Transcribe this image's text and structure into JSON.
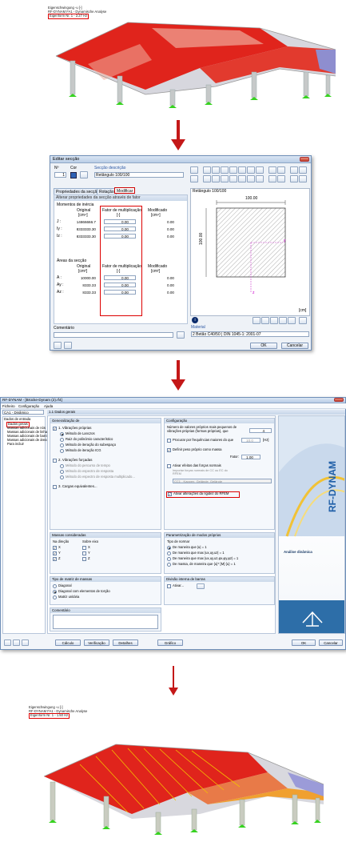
{
  "top_model": {
    "title_line1": "Eigenschwingung -u [-]",
    "title_line2": "RF-DYNAM FA1 - Dynamische Analyse",
    "title_line3": "Eigenform Nr. 1 - 2.27 Hz"
  },
  "section_dialog": {
    "title": "Editar secção",
    "number_label": "Nº",
    "number_value": "1",
    "color_label": "Cor",
    "desc_label": "Secção descrição",
    "desc_value": "Retângulo 100/100",
    "tabs": [
      "Propriedades da secção",
      "Rotação",
      "Modificar"
    ],
    "panel_title": "Alterar propriedades da secção através de fator",
    "inertia_title": "Momentos de inércia",
    "col_original": "Original",
    "col_original_unit1": "[cm⁴]",
    "col_factor": "Fator de multiplicação",
    "col_factor_unit": "[-]",
    "col_modified": "Modificado",
    "col_modified_unit1": "[cm⁴]",
    "inertia_rows": [
      {
        "sym": "J :",
        "orig": "14866666.7",
        "factor": "0.00",
        "mod": "0.00"
      },
      {
        "sym": "Iy :",
        "orig": "8333333.30",
        "factor": "0.00",
        "mod": "0.00"
      },
      {
        "sym": "Iz :",
        "orig": "8333333.30",
        "factor": "0.00",
        "mod": "0.00"
      }
    ],
    "area_title": "Áreas da secção",
    "col_original_unit2": "[cm²]",
    "col_modified_unit2": "[cm²]",
    "area_rows": [
      {
        "sym": "A :",
        "orig": "10000.00",
        "factor": "0.00",
        "mod": "0.00"
      },
      {
        "sym": "Ay :",
        "orig": "8333.33",
        "factor": "0.00",
        "mod": "0.00"
      },
      {
        "sym": "Az :",
        "orig": "8333.33",
        "factor": "0.00",
        "mod": "0.00"
      }
    ],
    "comment_label": "Comentário",
    "preview_title": "Retângulo 100/100",
    "dim_top": "100.00",
    "dim_left": "100.00",
    "axis_y": "y",
    "axis_z": "z",
    "unit": "[cm]",
    "material_label": "Material",
    "material_value": "2  Betão C40/50 | DIN 1045-1: 2001-07",
    "ok": "OK",
    "cancel": "Cancelar"
  },
  "dynam_dialog": {
    "title": "RF-DYNAM - [Brücke-Dynam (2).rf4]",
    "menu": [
      "Ficheiro",
      "Configuração",
      "Ajuda"
    ],
    "case_value": "CA1 - Dinâmico",
    "section_header": "1.1 Dados gerais",
    "nav_root": "Dados de entrada",
    "nav_items": [
      "Dados gerais",
      "Massas adicionais de nós",
      "Massas adicionais de linha",
      "Massas adicionais de barra",
      "Massas adicionais de área",
      "Para incluir"
    ],
    "gen_title": "Generalização de",
    "chk_eigen": "1. Vibrações próprias",
    "methods": [
      "Método de Lanczos",
      "Raiz do polinómio característico",
      "Método de iteração do subespaço",
      "Método de iteração ICG"
    ],
    "chk_forced": "2. Vibrações forçadas",
    "forced_methods": [
      "Método do percurso de tempo",
      "Método do espectro de resposta",
      "Método do espectro de resposta multiplicado..."
    ],
    "chk_equiv": "3. Cargas equivalentes...",
    "cfg_title": "Configuração",
    "cfg_count_label": "Número de valores próprios mais pequenos de vibrações próprias (formas próprias), que",
    "cfg_count_value": "4",
    "cfg_freq_label": "Procurar por frequências maiores do que",
    "cfg_freq_value": "10.0",
    "cfg_freq_unit": "[Hz]",
    "cfg_selfweight": "Definir peso próprio como massa",
    "cfg_factor_label": "Fator:",
    "cfg_factor_value": "1.00",
    "cfg_axial": "Ativar efeitos das forças normais",
    "cfg_axial_sub": "Importar forças normais de CC ou EC do RFEM",
    "cfg_lc_value": "CC1 - Kappen, Gelände, Gelände",
    "cfg_stiffness": "Ativar alterações da rigidez do RFEM",
    "masses_title": "Massas consideradas",
    "in_dir": "Na direção",
    "about_axis": "Sobre eixo",
    "axes": [
      "X",
      "Y",
      "Z"
    ],
    "norm_title": "Parametrização de modos próprios",
    "norm_type": "Tipo de normar",
    "norms": [
      "De maneira que |u| = 1",
      "De maneira que max |ux,uy,uz| = 1",
      "De maneira que max |ux,uy,uz,φx,φy,φz| = 1",
      "De massa, de maneira que {u}ᵀ [M] {u} = 1"
    ],
    "matrix_title": "Tipo de matriz de massas",
    "matrices": [
      "Diagonal",
      "Diagonal com elementos de torção",
      "Matriz unitária"
    ],
    "division_title": "Divisão interna de barras",
    "division_chk": "Ativar...",
    "comment_title": "Comentário",
    "brand": "RF-DYNAM",
    "brand_sub": "Análise dinâmica",
    "bottom_buttons": [
      "Cálculo",
      "Verificação",
      "Detalhes",
      "Gráfico"
    ],
    "ok": "OK",
    "cancel": "Cancelar"
  },
  "bottom_model": {
    "title_line1": "Eigenschwingung -u [-]",
    "title_line2": "RF-DYNAM FA1 - Dynamische Analyse",
    "title_line3": "Eigenform Nr. 1 - 1.50 Hz"
  },
  "colors": {
    "accent_red": "#cc0000",
    "deck_red": "#e0241c",
    "support_green": "#33cc22",
    "arrow_red": "#c41818"
  }
}
